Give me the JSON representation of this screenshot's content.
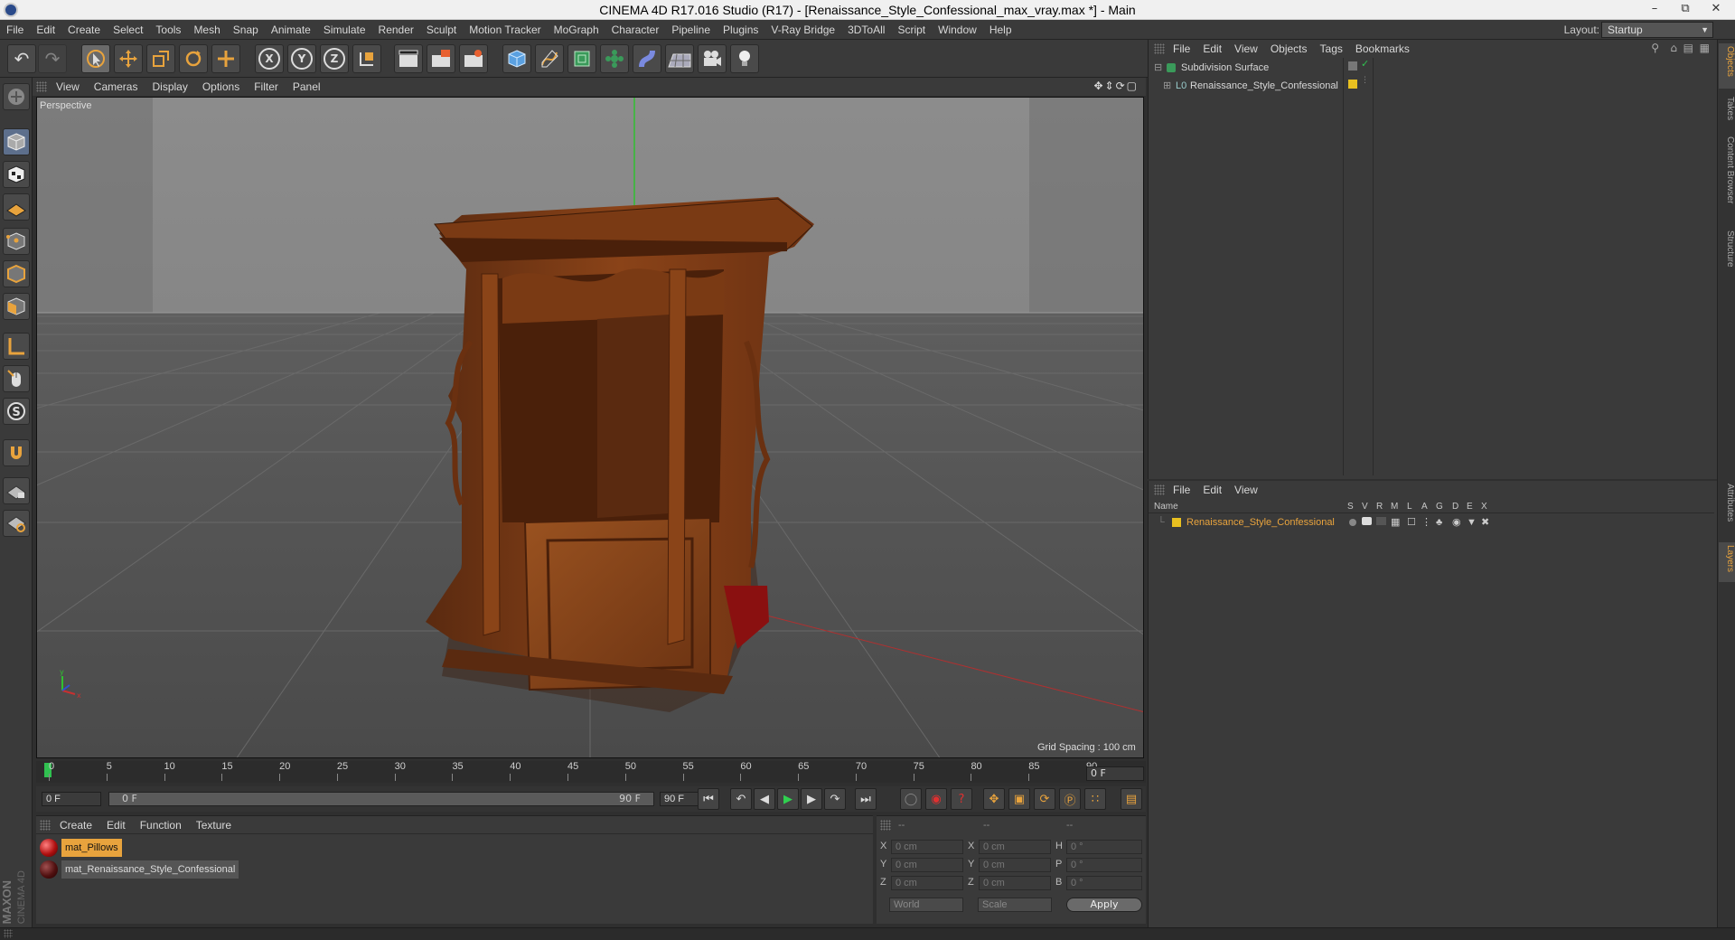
{
  "window": {
    "title": "CINEMA 4D R17.016 Studio (R17) - [Renaissance_Style_Confessional_max_vray.max *] - Main"
  },
  "menubar": {
    "items": [
      "File",
      "Edit",
      "Create",
      "Select",
      "Tools",
      "Mesh",
      "Snap",
      "Animate",
      "Simulate",
      "Render",
      "Sculpt",
      "Motion Tracker",
      "MoGraph",
      "Character",
      "Pipeline",
      "Plugins",
      "V-Ray Bridge",
      "3DToAll",
      "Script",
      "Window",
      "Help"
    ],
    "layout_label": "Layout:",
    "layout_value": "Startup"
  },
  "viewport": {
    "menu": [
      "View",
      "Cameras",
      "Display",
      "Options",
      "Filter",
      "Panel"
    ],
    "camera_label": "Perspective",
    "grid_spacing": "Grid Spacing : 100 cm"
  },
  "timeline": {
    "ticks": [
      "0",
      "5",
      "10",
      "15",
      "20",
      "25",
      "30",
      "35",
      "40",
      "45",
      "50",
      "55",
      "60",
      "65",
      "70",
      "75",
      "80",
      "85",
      "90"
    ],
    "current_frame": "0 F",
    "start_field": "0 F",
    "range_start": "0 F",
    "range_end": "90 F",
    "end_field": "90 F"
  },
  "materials": {
    "menu": [
      "Create",
      "Edit",
      "Function",
      "Texture"
    ],
    "items": [
      {
        "name": "mat_Pillows",
        "selected": true
      },
      {
        "name": "mat_Renaissance_Style_Confessional",
        "selected": false
      }
    ]
  },
  "coordinates": {
    "header": [
      "--",
      "--",
      "--"
    ],
    "rows": [
      {
        "axis1": "X",
        "val1": "0 cm",
        "axis2": "X",
        "val2": "0 cm",
        "axis3": "H",
        "val3": "0 °"
      },
      {
        "axis1": "Y",
        "val1": "0 cm",
        "axis2": "Y",
        "val2": "0 cm",
        "axis3": "P",
        "val3": "0 °"
      },
      {
        "axis1": "Z",
        "val1": "0 cm",
        "axis2": "Z",
        "val2": "0 cm",
        "axis3": "B",
        "val3": "0 °"
      }
    ],
    "mode1": "World",
    "mode2": "Scale",
    "apply": "Apply"
  },
  "object_manager": {
    "menu": [
      "File",
      "Edit",
      "View",
      "Objects",
      "Tags",
      "Bookmarks"
    ],
    "objects": [
      {
        "name": "Subdivision Surface",
        "level": 0
      },
      {
        "name": "Renaissance_Style_Confessional",
        "level": 1
      }
    ]
  },
  "layer_manager": {
    "menu": [
      "File",
      "Edit",
      "View"
    ],
    "columns": [
      "Name",
      "S",
      "V",
      "R",
      "M",
      "L",
      "A",
      "G",
      "D",
      "E",
      "X"
    ],
    "layers": [
      {
        "name": "Renaissance_Style_Confessional",
        "color": "#e8c020"
      }
    ]
  },
  "side_tabs": [
    "Objects",
    "Takes",
    "Content Browser",
    "Structure",
    "Attributes",
    "Layers"
  ],
  "branding": {
    "maxon": "MAXON",
    "product": "CINEMA 4D"
  },
  "colors": {
    "accent": "#e8a33d",
    "layer_yellow": "#e8c020",
    "axis_x": "#c83030",
    "axis_y": "#30c030",
    "axis_z": "#3050d0"
  }
}
